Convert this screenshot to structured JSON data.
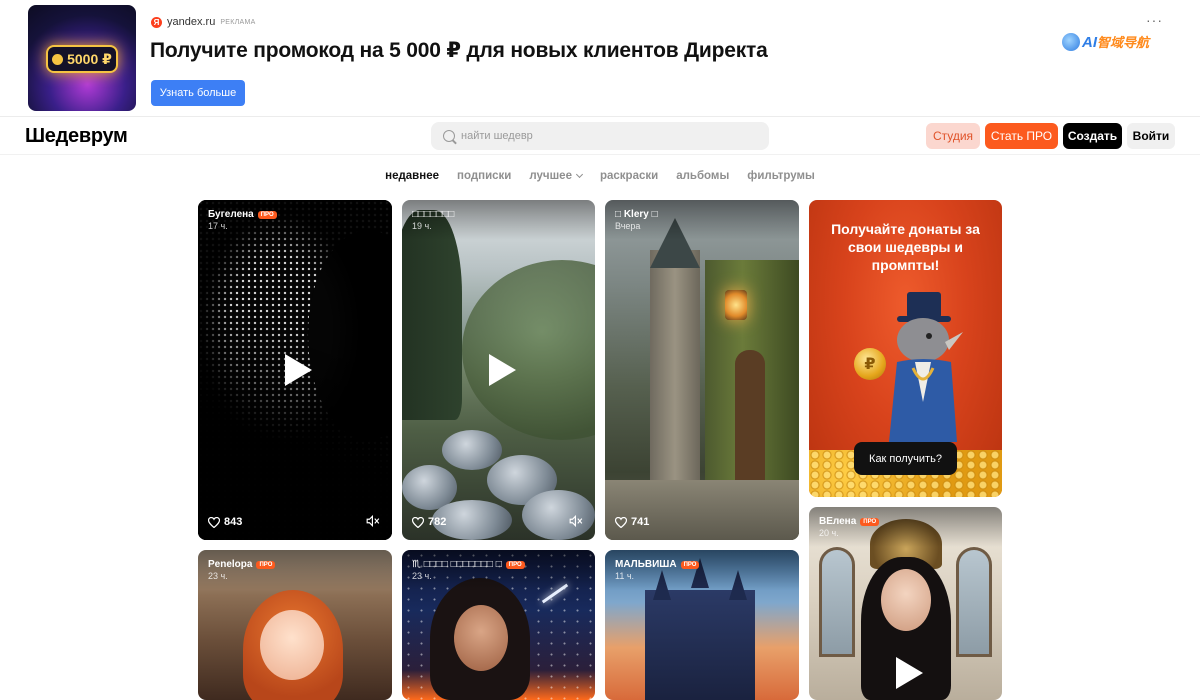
{
  "ad": {
    "thumb_text": "5000 ₽",
    "source": "yandex.ru",
    "source_tag": "РЕКЛАМА",
    "title": "Получите промокод на 5 000 ₽ для новых клиентов Директа",
    "cta": "Узнать больше",
    "more": "···",
    "watermark_ai": "AI",
    "watermark_cn": "智域导航"
  },
  "header": {
    "logo": "Шедеврум",
    "search_placeholder": "найти шедевр",
    "studio": "Студия",
    "get_pro": "Стать ПРО",
    "create": "Создать",
    "login": "Войти"
  },
  "tabs": [
    {
      "label": "недавнее",
      "active": true
    },
    {
      "label": "подписки",
      "active": false
    },
    {
      "label": "лучшее",
      "active": false
    },
    {
      "label": "раскраски",
      "active": false
    },
    {
      "label": "альбомы",
      "active": false
    },
    {
      "label": "фильтрумы",
      "active": false
    }
  ],
  "cards": [
    {
      "author": "Бугелена",
      "pro": "ПРО",
      "time": "17 ч.",
      "likes": "843",
      "video": true
    },
    {
      "author": "□□□□□□□",
      "pro": "",
      "time": "19 ч.",
      "likes": "782",
      "video": true
    },
    {
      "author": "□ Klery □",
      "pro": "",
      "time": "Вчера",
      "likes": "741",
      "video": false
    },
    {
      "author": "Penelopa",
      "pro": "ПРО",
      "time": "23 ч."
    },
    {
      "author": "♏ □□□□ □□□□□□□ □",
      "pro": "ПРО",
      "time": "23 ч."
    },
    {
      "author": "МАЛЬВИША",
      "pro": "ПРО",
      "time": "11 ч."
    },
    {
      "author": "ВЕлена",
      "pro": "ПРО",
      "time": "20 ч."
    }
  ],
  "promo": {
    "title": "Получайте донаты за свои шедевры и промпты!",
    "coin": "₽",
    "button": "Как получить?"
  },
  "colors": {
    "accent_orange": "#fc5a1e",
    "ad_button": "#3d7ff5",
    "studio_bg": "#fbd7cf"
  },
  "icons": [
    "search-icon",
    "heart-icon",
    "mute-icon",
    "play-icon",
    "chevron-down-icon",
    "more-icon",
    "yandex-logo-icon"
  ]
}
